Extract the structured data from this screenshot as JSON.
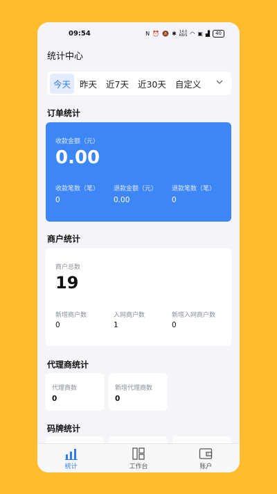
{
  "status_bar": {
    "time": "09:54",
    "network_speed_value": "14.0",
    "network_speed_unit": "KB/S",
    "battery": "40"
  },
  "header": {
    "title": "统计中心"
  },
  "date_tabs": [
    {
      "label": "今天",
      "active": true
    },
    {
      "label": "昨天",
      "active": false
    },
    {
      "label": "近7天",
      "active": false
    },
    {
      "label": "近30天",
      "active": false
    },
    {
      "label": "自定义",
      "active": false
    }
  ],
  "order_stats": {
    "title": "订单统计",
    "amount_label": "收款金额（元）",
    "amount_value": "0.00",
    "metrics": [
      {
        "label": "收款笔数（笔）",
        "value": "0"
      },
      {
        "label": "退款金额（元）",
        "value": "0.00"
      },
      {
        "label": "退款笔数（笔）",
        "value": "0"
      }
    ]
  },
  "merchant_stats": {
    "title": "商户统计",
    "total_label": "商户总数",
    "total_value": "19",
    "metrics": [
      {
        "label": "新增商户数",
        "value": "0"
      },
      {
        "label": "入网商户数",
        "value": "1"
      },
      {
        "label": "新增入网商户数",
        "value": "0"
      }
    ]
  },
  "agent_stats": {
    "title": "代理商统计",
    "cards": [
      {
        "label": "代理商数",
        "value": "0"
      },
      {
        "label": "新增代理商数",
        "value": "0"
      }
    ]
  },
  "code_stats": {
    "title": "码牌统计"
  },
  "bottom_nav": [
    {
      "label": "统计",
      "icon": "bar-chart-icon",
      "active": true
    },
    {
      "label": "工作台",
      "icon": "grid-icon",
      "active": false
    },
    {
      "label": "账户",
      "icon": "wallet-icon",
      "active": false
    }
  ],
  "colors": {
    "accent": "#3D86F6",
    "background": "#FFBC2E",
    "active_tab_bg": "#E3EDFF"
  }
}
